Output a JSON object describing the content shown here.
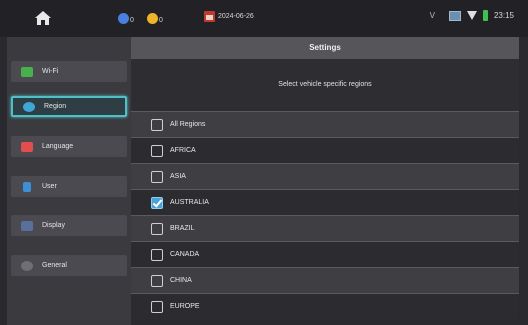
{
  "statusbar": {
    "home_icon": "home-icon",
    "badge_blue": {
      "count": "0",
      "color": "#4a7fe0"
    },
    "badge_yellow": {
      "count": "0",
      "color": "#f0b429"
    },
    "calendar_date": "2024-06-26",
    "v_label": "V",
    "time": "23:15"
  },
  "sidebar": {
    "items": [
      {
        "label": "Wi-Fi",
        "icon": "wifi-icon",
        "color": "#47b04c",
        "active": false
      },
      {
        "label": "Region",
        "icon": "region-icon",
        "color": "#3fa7d6",
        "active": true
      },
      {
        "label": "Language",
        "icon": "language-icon",
        "color": "#e24d4d",
        "active": false
      },
      {
        "label": "User",
        "icon": "user-icon",
        "color": "#3f8fd6",
        "active": false
      },
      {
        "label": "Display",
        "icon": "display-icon",
        "color": "#5a6f99",
        "active": false
      },
      {
        "label": "General",
        "icon": "general-icon",
        "color": "#6e6e74",
        "active": false
      }
    ]
  },
  "main": {
    "title": "Settings",
    "hint": "Select vehicle specific regions",
    "regions": [
      {
        "label": "All Regions",
        "checked": false
      },
      {
        "label": "AFRICA",
        "checked": false
      },
      {
        "label": "ASIA",
        "checked": false
      },
      {
        "label": "AUSTRALIA",
        "checked": true
      },
      {
        "label": "BRAZIL",
        "checked": false
      },
      {
        "label": "CANADA",
        "checked": false
      },
      {
        "label": "CHINA",
        "checked": false
      },
      {
        "label": "EUROPE",
        "checked": false
      }
    ]
  },
  "colors": {
    "accent": "#4fc0c8",
    "checked": "#4aa3d8"
  }
}
